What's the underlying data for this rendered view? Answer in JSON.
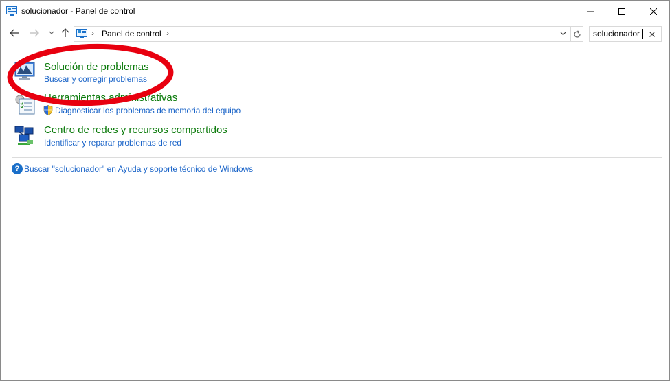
{
  "window": {
    "title": "solucionador - Panel de control",
    "controls": {
      "minimize": "minimize-icon",
      "maximize": "maximize-icon",
      "close": "close-icon"
    }
  },
  "nav": {
    "back": "arrow-left-icon",
    "forward": "arrow-right-icon",
    "recent": "chevron-down-icon",
    "up": "arrow-up-icon"
  },
  "address": {
    "crumb": "Panel de control",
    "separator": "›"
  },
  "search": {
    "value": "solucionador",
    "clear": "×"
  },
  "results": [
    {
      "title": "Solución de problemas",
      "links": [
        "Buscar y corregir problemas"
      ],
      "icon": "troubleshooting-icon"
    },
    {
      "title": "Herramientas administrativas",
      "links": [
        "Diagnosticar los problemas de memoria del equipo"
      ],
      "icon": "admin-tools-icon"
    },
    {
      "title": "Centro de redes y recursos compartidos",
      "links": [
        "Identificar y reparar problemas de red"
      ],
      "icon": "network-center-icon"
    }
  ],
  "help": {
    "text": "Buscar \"solucionador\" en Ayuda y soporte técnico de Windows",
    "icon": "?"
  },
  "colors": {
    "title_green": "#0a7a0a",
    "link_blue": "#1a64c8",
    "annotation_red": "#e8000f"
  }
}
